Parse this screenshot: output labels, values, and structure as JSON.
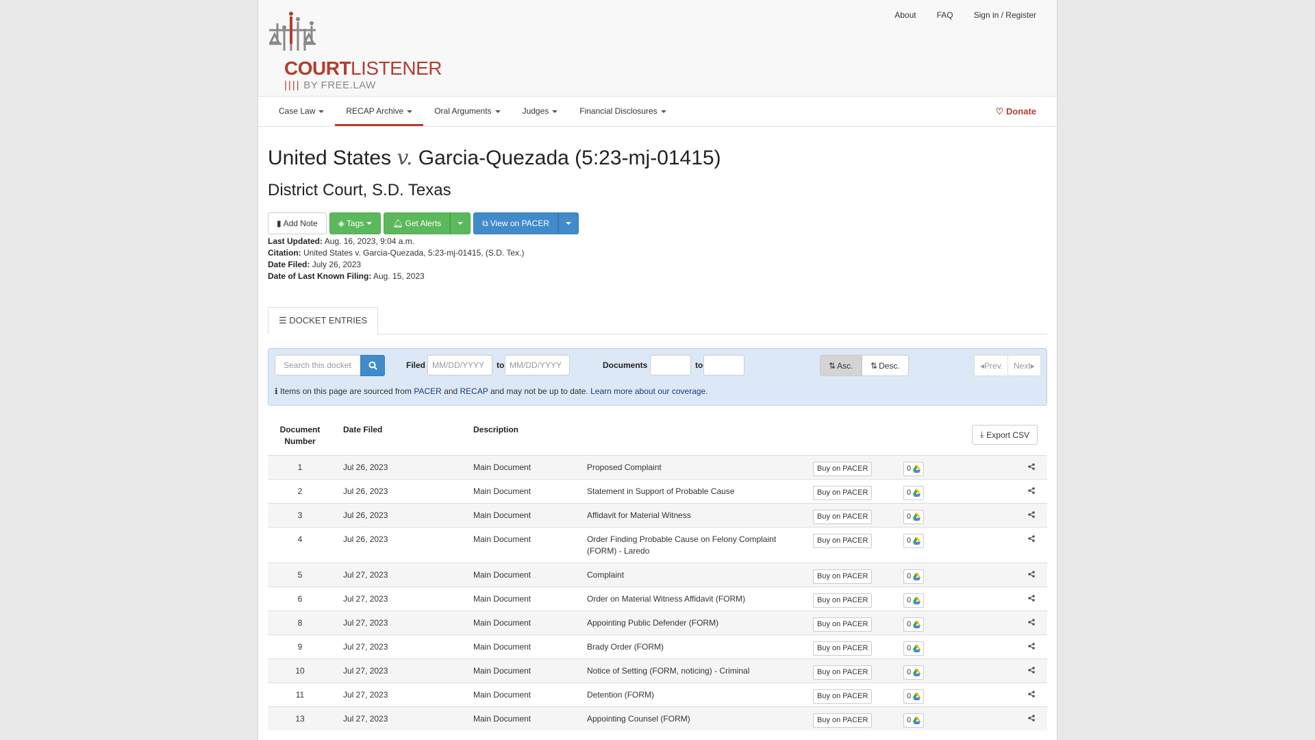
{
  "header": {
    "logo_court": "COURT",
    "logo_listener": "LISTENER",
    "logo_sub": "BY FREE.LAW",
    "links": [
      "About",
      "FAQ",
      "Sign in / Register"
    ]
  },
  "nav": {
    "items": [
      "Case Law",
      "RECAP Archive",
      "Oral Arguments",
      "Judges",
      "Financial Disclosures"
    ],
    "donate": "Donate"
  },
  "case": {
    "title_left": "United States",
    "title_v": "v.",
    "title_right": "Garcia-Quezada (5:23-mj-01415)",
    "court": "District Court, S.D. Texas"
  },
  "actions": {
    "add_note": "Add Note",
    "tags": "Tags",
    "get_alerts": "Get Alerts",
    "view_pacer": "View on PACER"
  },
  "meta": {
    "last_updated_label": "Last Updated:",
    "last_updated": "Aug. 16, 2023, 9:04 a.m.",
    "citation_label": "Citation:",
    "citation": "United States v. Garcia-Quezada, 5:23-mj-01415, (S.D. Tex.)",
    "date_filed_label": "Date Filed:",
    "date_filed": "July 26, 2023",
    "last_filing_label": "Date of Last Known Filing:",
    "last_filing": "Aug. 15, 2023"
  },
  "tab": {
    "label": "DOCKET ENTRIES"
  },
  "filters": {
    "search_placeholder": "Search this docket",
    "filed_label": "Filed",
    "date_placeholder": "MM/DD/YYYY",
    "to": "to",
    "documents_label": "Documents",
    "asc": "Asc.",
    "desc": "Desc.",
    "prev": "Prev.",
    "next": "Next",
    "notice_pre": "Items on this page are sourced from",
    "notice_pacer": "PACER",
    "notice_and": "and",
    "notice_recap": "RECAP",
    "notice_mid": "and may not be up to date.",
    "notice_link": "Learn more about our coverage."
  },
  "table": {
    "headers": {
      "doc_number": "Document Number",
      "date_filed": "Date Filed",
      "description": "Description"
    },
    "export": "Export CSV",
    "buy_label": "Buy on PACER",
    "rows": [
      {
        "num": "1",
        "date": "Jul 26, 2023",
        "type": "Main Document",
        "desc": "Proposed Complaint",
        "count": "0"
      },
      {
        "num": "2",
        "date": "Jul 26, 2023",
        "type": "Main Document",
        "desc": "Statement in Support of Probable Cause",
        "count": "0"
      },
      {
        "num": "3",
        "date": "Jul 26, 2023",
        "type": "Main Document",
        "desc": "Affidavit for Material Witness",
        "count": "0"
      },
      {
        "num": "4",
        "date": "Jul 26, 2023",
        "type": "Main Document",
        "desc": "Order Finding Probable Cause on Felony Complaint (FORM) - Laredo",
        "count": "0"
      },
      {
        "num": "5",
        "date": "Jul 27, 2023",
        "type": "Main Document",
        "desc": "Complaint",
        "count": "0"
      },
      {
        "num": "6",
        "date": "Jul 27, 2023",
        "type": "Main Document",
        "desc": "Order on Material Witness Affidavit (FORM)",
        "count": "0"
      },
      {
        "num": "8",
        "date": "Jul 27, 2023",
        "type": "Main Document",
        "desc": "Appointing Public Defender (FORM)",
        "count": "0"
      },
      {
        "num": "9",
        "date": "Jul 27, 2023",
        "type": "Main Document",
        "desc": "Brady Order (FORM)",
        "count": "0"
      },
      {
        "num": "10",
        "date": "Jul 27, 2023",
        "type": "Main Document",
        "desc": "Notice of Setting (FORM, noticing) - Criminal",
        "count": "0"
      },
      {
        "num": "11",
        "date": "Jul 27, 2023",
        "type": "Main Document",
        "desc": "Detention (FORM)",
        "count": "0"
      },
      {
        "num": "13",
        "date": "Jul 27, 2023",
        "type": "Main Document",
        "desc": "Appointing Counsel (FORM)",
        "count": "0"
      }
    ]
  },
  "colors": {
    "brand": "#b53c2e",
    "green": "#5cb85c",
    "blue": "#428bca",
    "filter_bg": "#dce8f6"
  }
}
